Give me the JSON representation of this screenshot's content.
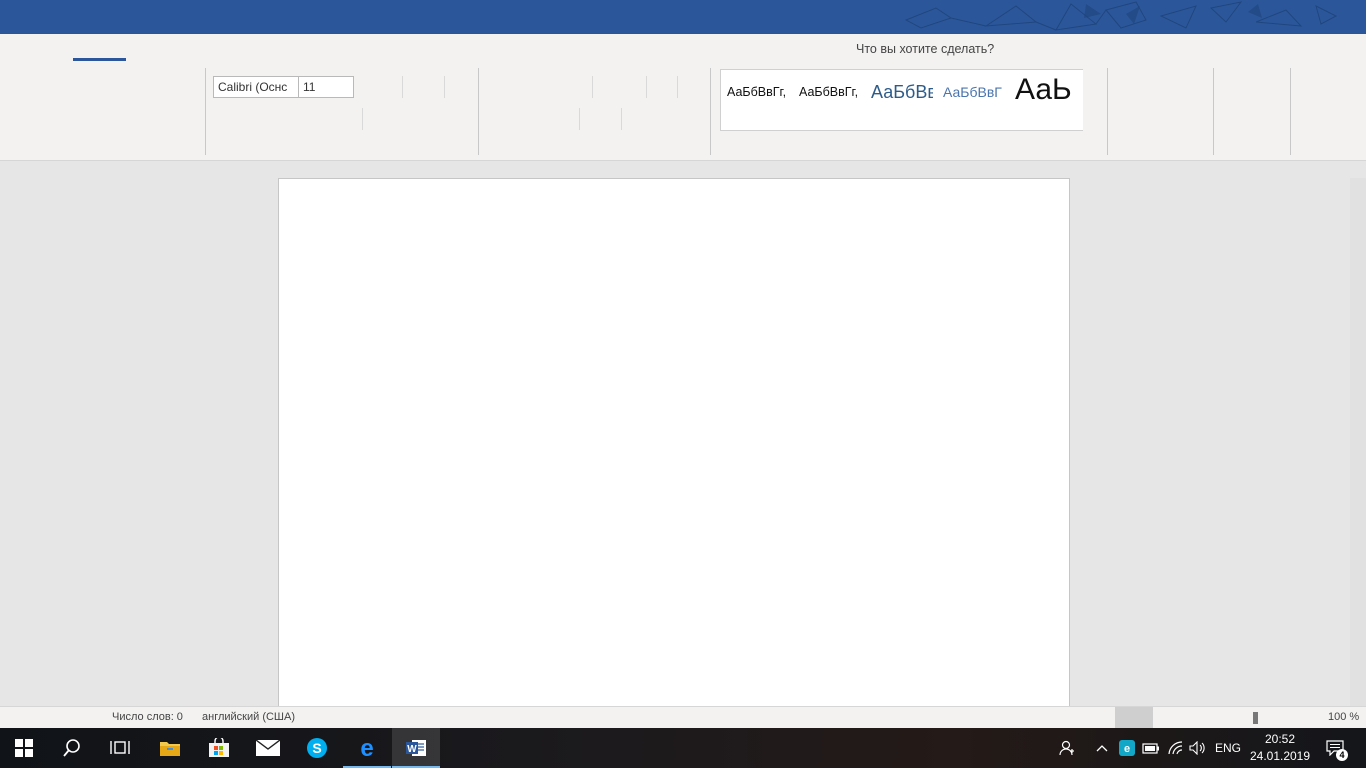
{
  "ribbon": {
    "tell_me": "Что вы хотите сделать?",
    "font_name": "Calibri (Оснс",
    "font_size": "11",
    "styles": [
      "АаБбВвГг,",
      "АаБбВвГг,",
      "АаБбВв",
      "АаБбВвГ",
      "АаЬ"
    ]
  },
  "status": {
    "word_count": "Число слов: 0",
    "language": "английский (США)",
    "zoom": "100 %"
  },
  "taskbar": {
    "language": "ENG",
    "time": "20:52",
    "date": "24.01.2019",
    "notification_count": "4",
    "apps": [
      "start-icon",
      "search-icon",
      "task-view-icon",
      "file-explorer-icon",
      "store-icon",
      "mail-icon",
      "skype-icon",
      "edge-icon",
      "word-icon"
    ]
  },
  "colors": {
    "titlebar": "#2b579a",
    "ribbon": "#f3f2f1",
    "canvas": "#e6e6e6",
    "page": "#ffffff",
    "taskbar": "#16181c"
  }
}
